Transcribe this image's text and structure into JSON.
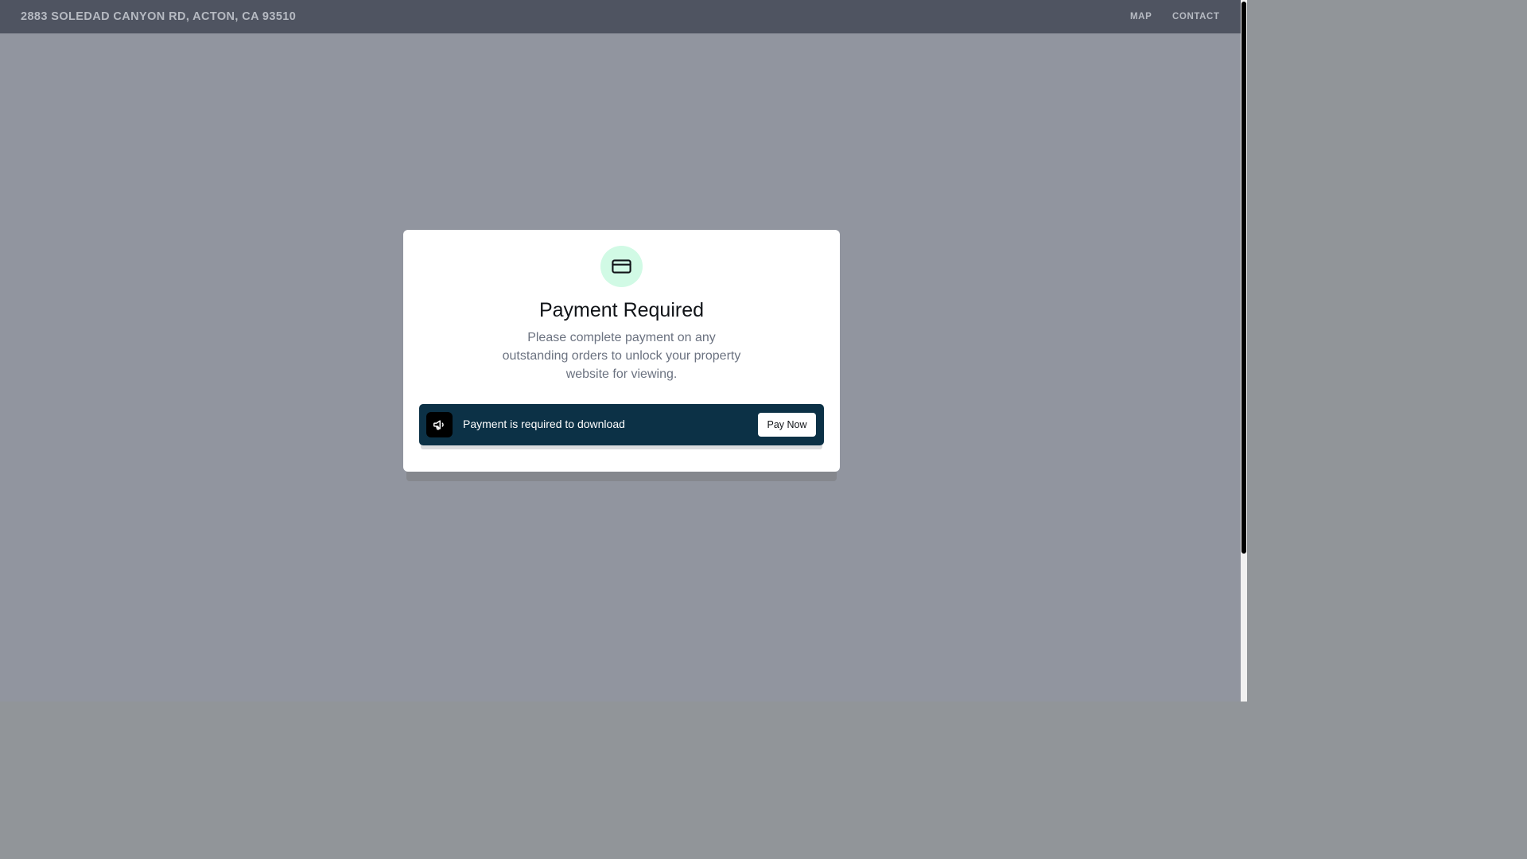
{
  "header": {
    "title": "2883 SOLEDAD CANYON RD, ACTON, CA 93510",
    "nav": [
      {
        "label": "MAP"
      },
      {
        "label": "CONTACT"
      }
    ]
  },
  "modal": {
    "icon": "credit-card-icon",
    "title": "Payment Required",
    "description": "Please complete payment on any outstanding orders to unlock your property website for viewing.",
    "banner": {
      "icon": "megaphone-icon",
      "message": "Payment is required to download",
      "button_label": "Pay Now"
    }
  },
  "colors": {
    "overlay": "#91959f",
    "header": "#4f5461",
    "icon_circle": "#d1fae5",
    "banner": "#0c3146"
  }
}
